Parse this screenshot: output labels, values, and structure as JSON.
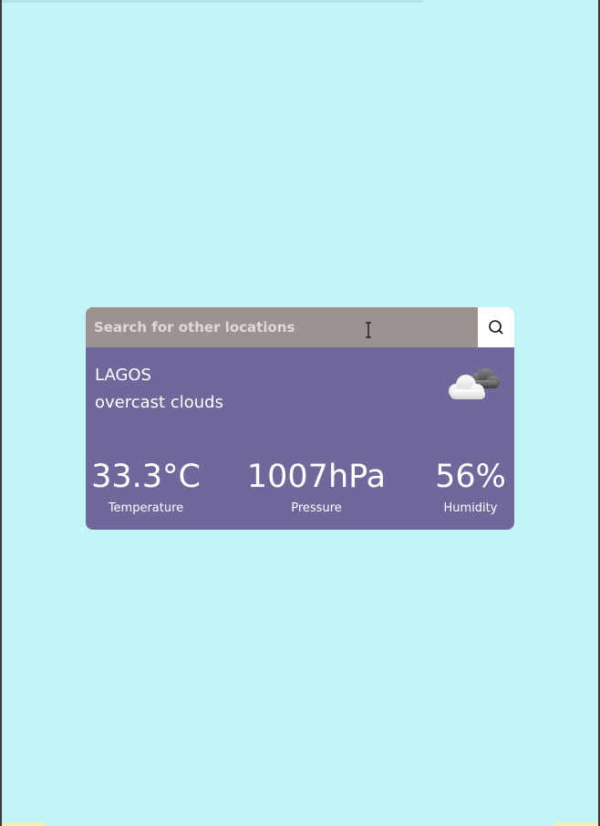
{
  "search": {
    "placeholder": "Search for other locations",
    "value": ""
  },
  "location": {
    "city": "LAGOS",
    "description": "overcast clouds"
  },
  "icons": {
    "search": "search-icon",
    "weather": "overcast-clouds-icon"
  },
  "stats": {
    "temperature": {
      "value": "33.3°C",
      "label": "Temperature"
    },
    "pressure": {
      "value": "1007hPa",
      "label": "Pressure"
    },
    "humidity": {
      "value": "56%",
      "label": "Humidity"
    }
  },
  "colors": {
    "page_background": "#c3f4f8",
    "card_background": "#6e689b",
    "search_background": "#9c9390",
    "search_button_background": "#ffffff"
  }
}
